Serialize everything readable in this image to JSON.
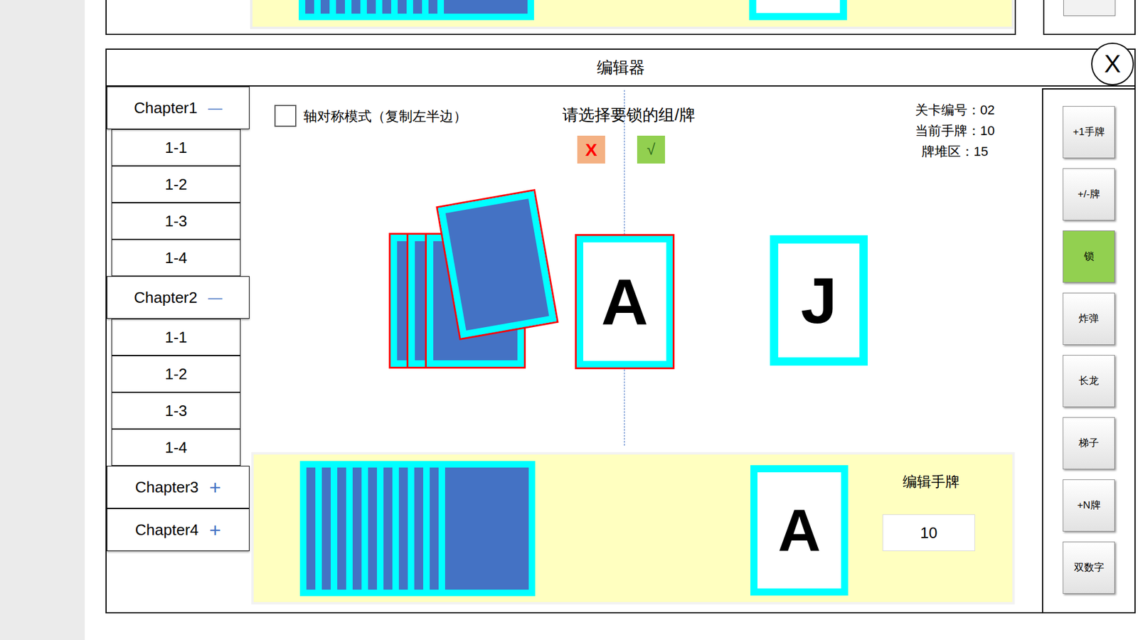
{
  "window": {
    "title": "编辑器",
    "close": "X"
  },
  "upper_panel": {
    "stack_count": 10
  },
  "sidebar": {
    "chapters": [
      {
        "label": "Chapter1",
        "toggle": "—",
        "expanded": true,
        "items": [
          "1-1",
          "1-2",
          "1-3",
          "1-4"
        ]
      },
      {
        "label": "Chapter2",
        "toggle": "—",
        "expanded": true,
        "items": [
          "1-1",
          "1-2",
          "1-3",
          "1-4"
        ]
      },
      {
        "label": "Chapter3",
        "toggle": "+",
        "expanded": false,
        "items": []
      },
      {
        "label": "Chapter4",
        "toggle": "+",
        "expanded": false,
        "items": []
      }
    ]
  },
  "canvas": {
    "symmetry": {
      "label": "轴对称模式（复制左半边）",
      "checked": false
    },
    "prompt": "请选择要锁的组/牌",
    "cancel": "X",
    "confirm": "√",
    "info": [
      {
        "label": "关卡编号：",
        "value": "02"
      },
      {
        "label": "当前手牌：",
        "value": "10"
      },
      {
        "label": "牌堆区：",
        "value": "15"
      }
    ],
    "cards": [
      {
        "kind": "back",
        "selected": true
      },
      {
        "kind": "back",
        "selected": true
      },
      {
        "kind": "back",
        "selected": true
      },
      {
        "kind": "back",
        "selected": true
      },
      {
        "kind": "face",
        "face": "A",
        "selected": true
      },
      {
        "kind": "face",
        "face": "J",
        "selected": false
      }
    ]
  },
  "hand": {
    "stack_count": 10,
    "face": "A",
    "label": "编辑手牌",
    "value": "10"
  },
  "tools": [
    {
      "label": "+1手牌",
      "selected": false
    },
    {
      "label": "+/-牌",
      "selected": false
    },
    {
      "label": "锁",
      "selected": true
    },
    {
      "label": "炸弹",
      "selected": false
    },
    {
      "label": "长龙",
      "selected": false
    },
    {
      "label": "梯子",
      "selected": false
    },
    {
      "label": "+N牌",
      "selected": false
    },
    {
      "label": "双数字",
      "selected": false
    }
  ]
}
